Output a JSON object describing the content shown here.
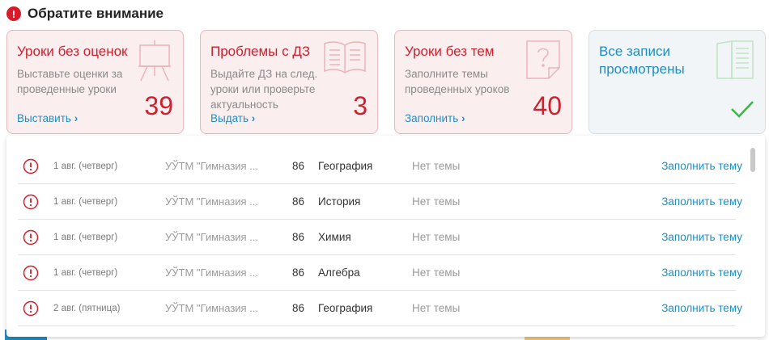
{
  "header": {
    "alert_glyph": "!",
    "title": "Обратите внимание"
  },
  "cards": [
    {
      "title": "Уроки без оценок",
      "desc": "Выставьте оценки за проведенные уроки",
      "link": "Выставить",
      "count": "39",
      "icon": "easel-icon"
    },
    {
      "title": "Проблемы с ДЗ",
      "desc": "Выдайте ДЗ на след. уроки или проверьте актуальность",
      "link": "Выдать",
      "count": "3",
      "icon": "open-book-icon"
    },
    {
      "title": "Уроки без тем",
      "desc": "Заполните темы проведенных уроков",
      "link": "Заполнить",
      "count": "40",
      "icon": "question-sheet-icon"
    },
    {
      "title": "Все записи просмотрены",
      "icon": "journal-icon",
      "status_icon": "check-icon"
    }
  ],
  "rows": [
    {
      "date": "1 авг. (четверг)",
      "school": "УЎТМ \"Гимназия ...",
      "num": "86",
      "subject": "География",
      "topic": "Нет темы",
      "action": "Заполнить тему"
    },
    {
      "date": "1 авг. (четверг)",
      "school": "УЎТМ \"Гимназия ...",
      "num": "86",
      "subject": "История",
      "topic": "Нет темы",
      "action": "Заполнить тему"
    },
    {
      "date": "1 авг. (четверг)",
      "school": "УЎТМ \"Гимназия ...",
      "num": "86",
      "subject": "Химия",
      "topic": "Нет темы",
      "action": "Заполнить тему"
    },
    {
      "date": "1 авг. (четверг)",
      "school": "УЎТМ \"Гимназия ...",
      "num": "86",
      "subject": "Алгебра",
      "topic": "Нет темы",
      "action": "Заполнить тему"
    },
    {
      "date": "2 авг. (пятница)",
      "school": "УЎТМ \"Гимназия ...",
      "num": "86",
      "subject": "География",
      "topic": "Нет темы",
      "action": "Заполнить тему"
    }
  ],
  "colors": {
    "accent_red": "#d0202e",
    "link_blue": "#1f8dc4",
    "check_green": "#3cb54a"
  }
}
